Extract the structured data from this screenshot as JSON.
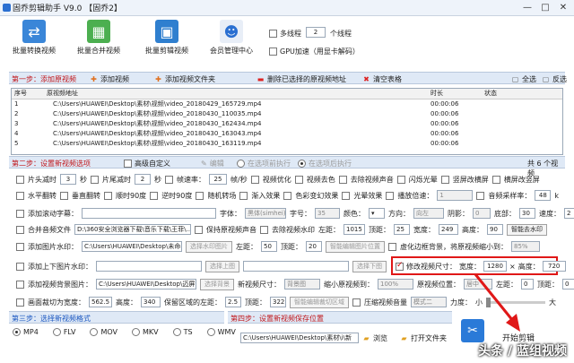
{
  "window": {
    "title": "固乔剪辑助手 V9.0  【固乔2】",
    "minimize": "—",
    "maximize": "□",
    "close": "✕"
  },
  "toolbar": {
    "items": [
      {
        "label": "批量转换视频"
      },
      {
        "label": "批量合并视频"
      },
      {
        "label": "批量剪辑视频"
      },
      {
        "label": "会员管理中心"
      }
    ],
    "multithread_label": "多线程",
    "thread_count": "2",
    "thread_unit": "个线程",
    "gpu_label": "GPU加速（用显卡解码）"
  },
  "step1": {
    "label": "第一步：添加原视频",
    "add_video": "添加视频",
    "add_folder": "添加视频文件夹",
    "delete_selected": "删除已选择的原视频地址",
    "clear_table": "清空表格",
    "select_all": "全选",
    "invert": "反选"
  },
  "table": {
    "headers": {
      "seq": "序号",
      "path": "原视频地址",
      "duration": "时长",
      "status": "状态"
    },
    "rows": [
      {
        "seq": "1",
        "path": "C:\\Users\\HUAWEI\\Desktop\\素材\\视频\\video_20180429_165729.mp4",
        "duration": "00:00:06",
        "status": ""
      },
      {
        "seq": "2",
        "path": "C:\\Users\\HUAWEI\\Desktop\\素材\\视频\\video_20180430_110035.mp4",
        "duration": "00:00:06",
        "status": ""
      },
      {
        "seq": "3",
        "path": "C:\\Users\\HUAWEI\\Desktop\\素材\\视频\\video_20180430_162434.mp4",
        "duration": "00:00:06",
        "status": ""
      },
      {
        "seq": "4",
        "path": "C:\\Users\\HUAWEI\\Desktop\\素材\\视频\\video_20180430_163043.mp4",
        "duration": "00:00:06",
        "status": ""
      },
      {
        "seq": "5",
        "path": "C:\\Users\\HUAWEI\\Desktop\\素材\\视频\\video_20180430_163119.mp4",
        "duration": "00:00:06",
        "status": ""
      }
    ]
  },
  "step2": {
    "label": "第二步：设置新视频选项",
    "advanced": "高级自定义",
    "edit": "编辑",
    "sequential": "在选项前执行",
    "after": "在选项后执行",
    "count_text": "共 6 个视频"
  },
  "row1": {
    "head_cut": "片头减时",
    "head_val": "3",
    "sec": "秒",
    "tail_cut": "片尾减时",
    "tail_val": "2",
    "sec2": "秒",
    "framerate": "帧速率：",
    "fr_val": "25",
    "fps": "帧/秒",
    "video_opt": "视频优化",
    "deband": "视频去色",
    "denoise": "去除视频声音",
    "flash": "闪烁光晕",
    "v_blur": "竖屏改横屏",
    "h_blur": "横屏改竖屏"
  },
  "row2": {
    "hflip": "水平翻转",
    "vflip": "垂直翻转",
    "rot90": "顺时90度",
    "rotm90": "逆时90度",
    "random_trans": "随机转场",
    "fade": "渐入效果",
    "colorshift": "色彩变幻效果",
    "light": "光晕效果",
    "speed_label": "播放倍速：",
    "speed_val": "1",
    "sample_label": "音频采样率：",
    "sample_val": "48",
    "sample_unit": "k"
  },
  "row3": {
    "subtitle": "添加滚动字幕：",
    "font": "字体：",
    "font_val": "黑体(simhei)",
    "size": "字号：",
    "size_val": "35",
    "color": "颜色：",
    "dir": "方向：",
    "dir_val": "向左",
    "shadow": "阴影：",
    "shadow_val": "0",
    "bottom": "底部：",
    "bottom_val": "30",
    "speed": "速度：",
    "speed_val": "2"
  },
  "row4": {
    "merge_audio": "合并音频文件",
    "audio_path": "D:\\360安全浏览器下载\\音乐下载\\王菲\\...",
    "keep_audio": "保持原视频声音",
    "remove_wm": "去除视频水印",
    "left": "左距：",
    "left_val": "1015",
    "top": "顶距：",
    "top_val": "25",
    "width": "宽度：",
    "width_val": "249",
    "height": "高度：",
    "height_val": "90",
    "smart": "智能去水印"
  },
  "row5": {
    "pic_wm": "添加图片水印：",
    "pic_path": "C:\\Users\\HUAWEI\\Desktop\\未命名15947...",
    "select_wm": "选择水印图片",
    "left": "左距：",
    "left_val": "50",
    "top": "顶距：",
    "top_val": "20",
    "smart_pos": "智能编辑图片位置",
    "blur_bg": "虚化边框背景，将原视频缩小到：",
    "blur_val": "85%"
  },
  "row6": {
    "prev_pic": "添加上下图片水印：",
    "up_pic": "选择上图",
    "down_pic": "选择下图",
    "resize": "修改视频尺寸：",
    "w_label": "宽度：",
    "w_val": "1280",
    "x": "×",
    "h_label": "高度：",
    "h_val": "720"
  },
  "row7": {
    "bg": "添加视频背景图片：",
    "bg_path": "C:\\Users\\HUAWEI\\Desktop\\迈屏背景...",
    "select_bg": "选择背景",
    "newsize": "新视频尺寸：",
    "newsize_val": "背景图",
    "shrink": "缩小原视频到：",
    "shrink_val": "100%",
    "pos": "原视频位置：",
    "pos_val": "居中",
    "left": "左距：",
    "left_val": "0",
    "top": "顶距：",
    "top_val": "0"
  },
  "row8": {
    "crop": "画面裁切为宽度：",
    "crop_w": "562.5",
    "crop_h_label": "高度：",
    "crop_h": "340",
    "keep_left": "保留区域的左距：",
    "keep_left_val": "2.5",
    "keep_top": "顶距：",
    "keep_top_val": "322",
    "smart_crop": "智能编辑裁切区域",
    "volume": "压缩视频音量",
    "mode_val": "模式二",
    "strength": "力度：",
    "small": "小",
    "big": "大"
  },
  "step3": {
    "label": "第三步：选择新视频格式",
    "formats": [
      "MP4",
      "FLV",
      "MOV",
      "MKV",
      "TS",
      "WMV"
    ],
    "selected": "MP4"
  },
  "step4": {
    "label": "第四步：设置新视频保存位置",
    "path": "C:\\Users\\HUAWEI\\Desktop\\素材\\i\\新",
    "browse": "浏览",
    "open_folder": "打开文件夹"
  },
  "start": {
    "label": "开始剪辑"
  },
  "watermark": "头条 / 蓝组视频"
}
